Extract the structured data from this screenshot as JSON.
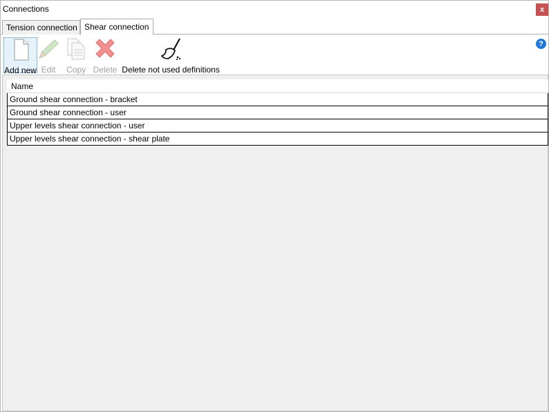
{
  "window": {
    "title": "Connections",
    "close_label": "x"
  },
  "tabs": [
    {
      "label": "Tension connection",
      "active": false
    },
    {
      "label": "Shear connection",
      "active": true
    }
  ],
  "toolbar": {
    "add_new": "Add new",
    "edit": "Edit",
    "copy": "Copy",
    "delete": "Delete",
    "delete_unused": "Delete not used definitions"
  },
  "help": {
    "icon": "help-icon",
    "glyph": "?"
  },
  "grid": {
    "header": "Name",
    "rows": [
      "Ground shear connection - bracket",
      "Ground shear connection - user",
      "Upper levels shear connection - user",
      "Upper levels shear connection - shear plate"
    ]
  },
  "colors": {
    "close": "#c75050",
    "help": "#1e78d8",
    "selected": "#e5f1fb",
    "content_bg": "#efefef"
  }
}
